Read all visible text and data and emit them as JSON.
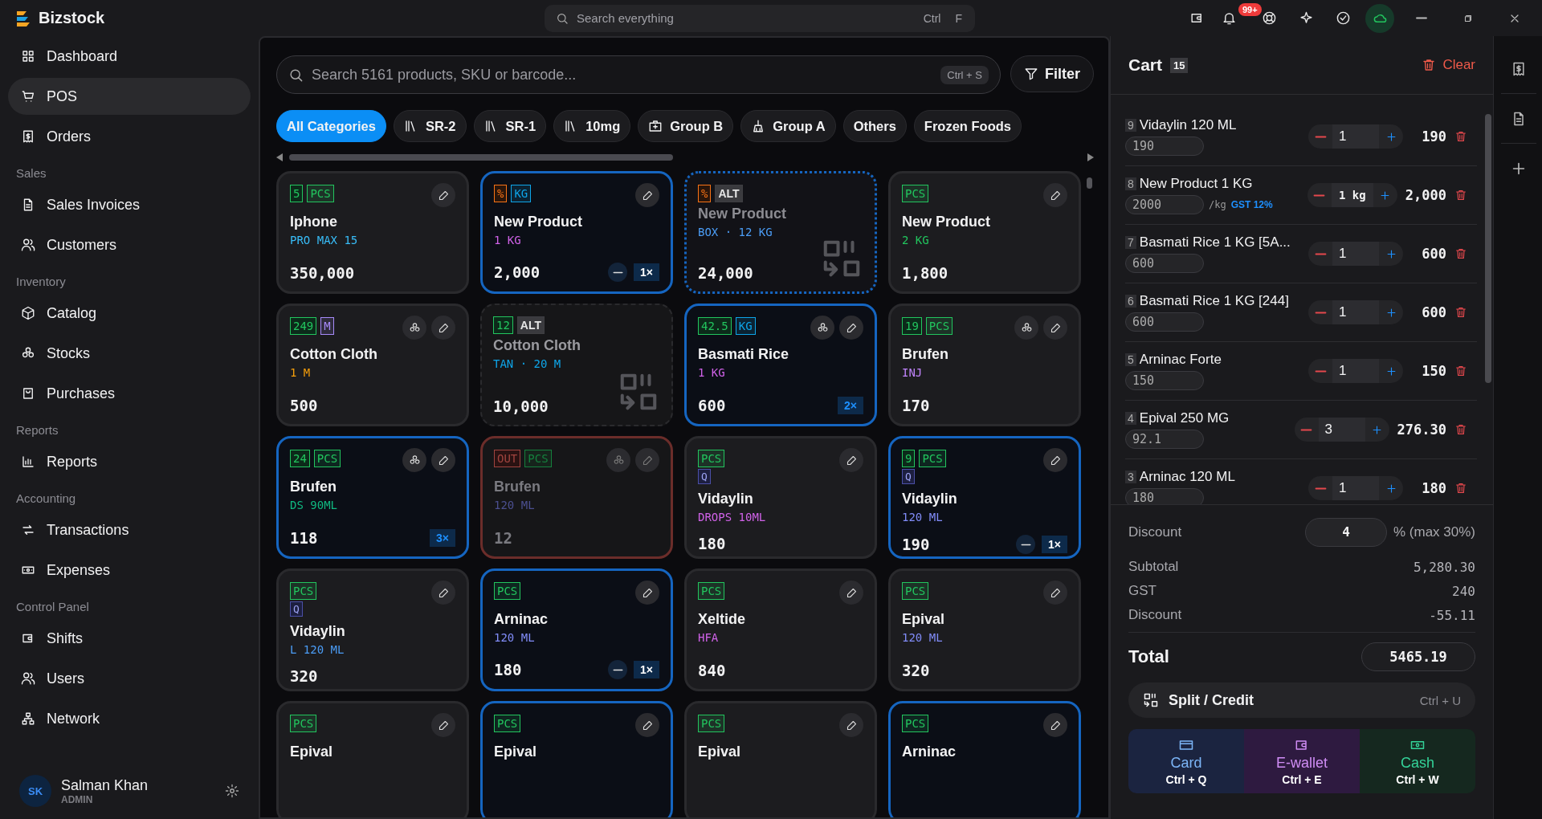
{
  "app": {
    "name": "Bizstock"
  },
  "top_search": {
    "placeholder": "Search everything",
    "keys": [
      "Ctrl",
      "F"
    ]
  },
  "notifications": {
    "badge": "99+"
  },
  "sidebar": {
    "sections": [
      {
        "items": [
          {
            "label": "Dashboard",
            "selected": false
          },
          {
            "label": "POS",
            "selected": true
          },
          {
            "label": "Orders",
            "selected": false
          }
        ]
      },
      {
        "heading": "Sales",
        "items": [
          {
            "label": "Sales Invoices",
            "selected": false
          },
          {
            "label": "Customers",
            "selected": false
          }
        ]
      },
      {
        "heading": "Inventory",
        "items": [
          {
            "label": "Catalog",
            "selected": false
          },
          {
            "label": "Stocks",
            "selected": false
          },
          {
            "label": "Purchases",
            "selected": false
          }
        ]
      },
      {
        "heading": "Reports",
        "items": [
          {
            "label": "Reports",
            "selected": false
          }
        ]
      },
      {
        "heading": "Accounting",
        "items": [
          {
            "label": "Transactions",
            "selected": false
          },
          {
            "label": "Expenses",
            "selected": false
          }
        ]
      },
      {
        "heading": "Control Panel",
        "items": [
          {
            "label": "Shifts",
            "selected": false
          },
          {
            "label": "Users",
            "selected": false
          },
          {
            "label": "Network",
            "selected": false
          }
        ]
      }
    ],
    "user": {
      "initials": "SK",
      "name": "Salman Khan",
      "role": "ADMIN"
    }
  },
  "product_search": {
    "placeholder": "Search 5161 products, SKU or barcode...",
    "shortcut": "Ctrl + S"
  },
  "filter_button": "Filter",
  "categories": [
    {
      "label": "All Categories",
      "selected": true,
      "kind": "plain"
    },
    {
      "label": "SR-2",
      "selected": false,
      "kind": "books"
    },
    {
      "label": "SR-1",
      "selected": false,
      "kind": "books"
    },
    {
      "label": "10mg",
      "selected": false,
      "kind": "books"
    },
    {
      "label": "Group B",
      "selected": false,
      "kind": "kit"
    },
    {
      "label": "Group A",
      "selected": false,
      "kind": "broom"
    },
    {
      "label": "Others",
      "selected": false,
      "kind": "plain"
    },
    {
      "label": "Frozen Foods",
      "selected": false,
      "kind": "plain"
    }
  ],
  "products": [
    {
      "kind": "normal",
      "selected": false,
      "badges": [
        {
          "text": "5",
          "kind": "count"
        },
        {
          "text": "PCS",
          "kind": "unit",
          "color": "#22c55e"
        }
      ],
      "stock_button": false,
      "name": "Iphone",
      "variant": "PRO MAX 15",
      "color": "#38bdf8",
      "price": "350,000"
    },
    {
      "kind": "normal",
      "selected": true,
      "badges": [
        {
          "text": "%",
          "kind": "percent"
        },
        {
          "text": "KG",
          "kind": "unit",
          "color": "#0ea5e9"
        }
      ],
      "stock_button": false,
      "name": "New Product",
      "variant": "1 KG",
      "color": "#d062e8",
      "price": "2,000",
      "qty": "1×",
      "removable": true
    },
    {
      "kind": "alt",
      "selected": true,
      "badges": [
        {
          "text": "%",
          "kind": "percent"
        },
        {
          "text": "ALT",
          "kind": "alt"
        }
      ],
      "stock_button": false,
      "name": "New Product",
      "variant": "BOX · 12 KG",
      "color": "#4b9cf5",
      "price": "24,000"
    },
    {
      "kind": "normal",
      "selected": false,
      "badges": [
        {
          "text": "PCS",
          "kind": "unit",
          "color": "#22c55e"
        }
      ],
      "stock_button": false,
      "name": "New Product",
      "variant": "2 KG",
      "color": "#22c55e",
      "price": "1,800"
    },
    {
      "kind": "normal",
      "selected": false,
      "badges": [
        {
          "text": "249",
          "kind": "count"
        },
        {
          "text": "M",
          "kind": "unit",
          "color": "#a78bfa"
        }
      ],
      "stock_button": true,
      "name": "Cotton Cloth",
      "variant": "1 M",
      "color": "#f59e0b",
      "price": "500"
    },
    {
      "kind": "alt",
      "selected": false,
      "badges": [
        {
          "text": "12",
          "kind": "count"
        },
        {
          "text": "ALT",
          "kind": "alt"
        }
      ],
      "stock_button": false,
      "name": "Cotton Cloth",
      "variant": "TAN · 20 M",
      "color": "#0ea5e9",
      "price": "10,000"
    },
    {
      "kind": "normal",
      "selected": true,
      "badges": [
        {
          "text": "42.5",
          "kind": "count"
        },
        {
          "text": "KG",
          "kind": "unit",
          "color": "#0ea5e9"
        }
      ],
      "stock_button": true,
      "name": "Basmati Rice",
      "variant": "1 KG",
      "color": "#d062e8",
      "price": "600",
      "qty": "2×",
      "removable": false
    },
    {
      "kind": "normal",
      "selected": false,
      "badges": [
        {
          "text": "19",
          "kind": "count"
        },
        {
          "text": "PCS",
          "kind": "unit",
          "color": "#22c55e"
        }
      ],
      "stock_button": true,
      "name": "Brufen",
      "variant": "INJ",
      "color": "#c084fc",
      "price": "170"
    },
    {
      "kind": "normal",
      "selected": true,
      "badges": [
        {
          "text": "24",
          "kind": "count"
        },
        {
          "text": "PCS",
          "kind": "unit",
          "color": "#22c55e"
        }
      ],
      "stock_button": true,
      "name": "Brufen",
      "variant": "DS 90ML",
      "color": "#10b981",
      "price": "118",
      "qty": "3×",
      "removable": false
    },
    {
      "kind": "out",
      "selected": false,
      "badges": [
        {
          "text": "OUT",
          "kind": "out"
        },
        {
          "text": "PCS",
          "kind": "unit",
          "color": "#15803d"
        }
      ],
      "stock_button": true,
      "name": "Brufen",
      "variant": "120 ML",
      "color": "#4b4f8f",
      "price": "12"
    },
    {
      "kind": "normal",
      "selected": false,
      "badges": [
        {
          "text": "PCS",
          "kind": "unit",
          "color": "#22c55e"
        }
      ],
      "tag": "Q",
      "stock_button": false,
      "name": "Vidaylin",
      "variant": "DROPS 10ML",
      "color": "#d062e8",
      "price": "180"
    },
    {
      "kind": "normal",
      "selected": true,
      "badges": [
        {
          "text": "9",
          "kind": "count"
        },
        {
          "text": "PCS",
          "kind": "unit",
          "color": "#22c55e"
        }
      ],
      "tag": "Q",
      "stock_button": false,
      "name": "Vidaylin",
      "variant": "120 ML",
      "color": "#818cf8",
      "price": "190",
      "qty": "1×",
      "removable": true
    },
    {
      "kind": "normal",
      "selected": false,
      "badges": [
        {
          "text": "PCS",
          "kind": "unit",
          "color": "#22c55e"
        }
      ],
      "tag": "Q",
      "stock_button": false,
      "name": "Vidaylin",
      "variant": "L 120 ML",
      "color": "#4b9cf5",
      "price": "320"
    },
    {
      "kind": "normal",
      "selected": true,
      "badges": [
        {
          "text": "PCS",
          "kind": "unit",
          "color": "#22c55e"
        }
      ],
      "stock_button": false,
      "name": "Arninac",
      "variant": "120 ML",
      "color": "#818cf8",
      "price": "180",
      "qty": "1×",
      "removable": true
    },
    {
      "kind": "normal",
      "selected": false,
      "badges": [
        {
          "text": "PCS",
          "kind": "unit",
          "color": "#22c55e"
        }
      ],
      "stock_button": false,
      "name": "Xeltide",
      "variant": "HFA",
      "color": "#d062e8",
      "price": "840"
    },
    {
      "kind": "normal",
      "selected": false,
      "badges": [
        {
          "text": "PCS",
          "kind": "unit",
          "color": "#22c55e"
        }
      ],
      "stock_button": false,
      "name": "Epival",
      "variant": "120 ML",
      "color": "#818cf8",
      "price": "320"
    },
    {
      "kind": "normal",
      "selected": false,
      "badges": [
        {
          "text": "PCS",
          "kind": "unit",
          "color": "#22c55e"
        }
      ],
      "stock_button": false,
      "name": "Epival"
    },
    {
      "kind": "normal",
      "selected": true,
      "badges": [
        {
          "text": "PCS",
          "kind": "unit",
          "color": "#22c55e"
        }
      ],
      "stock_button": false,
      "name": "Epival"
    },
    {
      "kind": "normal",
      "selected": false,
      "badges": [
        {
          "text": "PCS",
          "kind": "unit",
          "color": "#22c55e"
        }
      ],
      "stock_button": false,
      "name": "Epival"
    },
    {
      "kind": "normal",
      "selected": true,
      "badges": [
        {
          "text": "PCS",
          "kind": "unit",
          "color": "#22c55e"
        }
      ],
      "stock_button": false,
      "name": "Arninac"
    }
  ],
  "cart": {
    "title": "Cart",
    "count": "15",
    "clear": "Clear",
    "items": [
      {
        "index": "9",
        "name": "Vidaylin 120 ML",
        "rate": "190",
        "qty": "1",
        "amount": "190"
      },
      {
        "index": "8",
        "name": "New Product 1 KG",
        "rate": "2000",
        "rate_unit": "/kg",
        "tax": "GST 12%",
        "qty": "1 kg",
        "amount": "2,000"
      },
      {
        "index": "7",
        "name": "Basmati Rice 1 KG [5A...",
        "rate": "600",
        "qty": "1",
        "amount": "600"
      },
      {
        "index": "6",
        "name": "Basmati Rice 1 KG [244]",
        "rate": "600",
        "qty": "1",
        "amount": "600"
      },
      {
        "index": "5",
        "name": "Arninac Forte",
        "rate": "150",
        "qty": "1",
        "amount": "150"
      },
      {
        "index": "4",
        "name": "Epival 250 MG",
        "rate": "92.1",
        "qty": "3",
        "amount": "276.30"
      },
      {
        "index": "3",
        "name": "Arninac 120 ML",
        "rate": "180",
        "qty": "1",
        "amount": "180"
      }
    ]
  },
  "summary": {
    "discount_label": "Discount",
    "discount_value": "4",
    "discount_note": "% (max 30%)",
    "rows": [
      {
        "label": "Subtotal",
        "value": "5,280.30"
      },
      {
        "label": "GST",
        "value": "240"
      },
      {
        "label": "Discount",
        "value": "-55.11"
      }
    ],
    "total_label": "Total",
    "total": "5465.19"
  },
  "split_button": {
    "label": "Split / Credit",
    "shortcut": "Ctrl + U"
  },
  "payments": [
    {
      "kind": "card",
      "label": "Card",
      "shortcut": "Ctrl + Q"
    },
    {
      "kind": "ewallet",
      "label": "E-wallet",
      "shortcut": "Ctrl + E"
    },
    {
      "kind": "cash",
      "label": "Cash",
      "shortcut": "Ctrl + W"
    }
  ]
}
